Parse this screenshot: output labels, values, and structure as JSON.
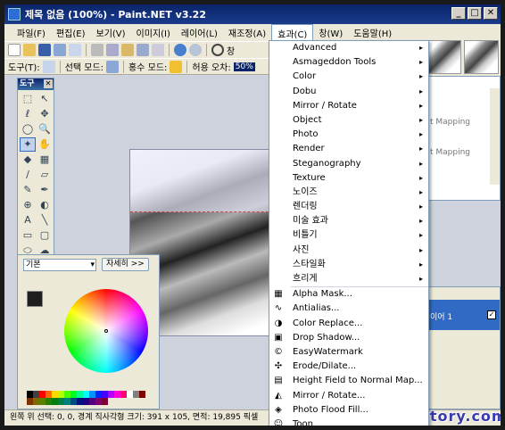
{
  "window": {
    "title": "제목 없음 (100%) - Paint.NET v3.22",
    "buttons": {
      "minimize": "_",
      "maximize": "□",
      "close": "✕"
    }
  },
  "menubar": {
    "items": [
      "파일(F)",
      "편집(E)",
      "보기(V)",
      "이미지(I)",
      "레이어(L)",
      "재조정(A)",
      "효과(C)",
      "창(W)",
      "도움말(H)"
    ],
    "active_index": 6
  },
  "toolbar1": {
    "zoom_label": "창"
  },
  "toolbar2": {
    "tool_label": "도구(T):",
    "selection_mode_label": "선택 모드:",
    "flood_mode_label": "홍수 모드:",
    "tolerance_label": "허용 오차:",
    "tolerance_value": "50%"
  },
  "tools_panel": {
    "title": "도구",
    "close": "✕",
    "icons": [
      "rect-select-icon",
      "move-selection-icon",
      "lasso-icon",
      "move-icon",
      "ellipse-select-icon",
      "zoom-icon",
      "magic-wand-icon",
      "pan-icon",
      "paint-bucket-icon",
      "gradient-icon",
      "paintbrush-icon",
      "eraser-icon",
      "pencil-icon",
      "color-picker-icon",
      "clone-stamp-icon",
      "recolor-icon",
      "text-icon",
      "line-icon",
      "rectangle-icon",
      "rounded-rect-icon",
      "ellipse-icon",
      "freeform-icon"
    ],
    "glyphs": [
      "⬚",
      "↖",
      "ℓ",
      "✥",
      "◯",
      "🔍",
      "✦",
      "✋",
      "◆",
      "▦",
      "∕",
      "▱",
      "✎",
      "✒",
      "⊕",
      "◐",
      "A",
      "╲",
      "▭",
      "▢",
      "⬭",
      "☁"
    ],
    "selected_index": 6
  },
  "colors_panel": {
    "palette_mode": "기본",
    "more_button": "자세히 >>",
    "primary_color": "#1e1e1e",
    "secondary_color": "#ffffff",
    "palette": [
      "#000000",
      "#404040",
      "#ff0000",
      "#ff6a00",
      "#ffd800",
      "#b6ff00",
      "#4cff00",
      "#00ff21",
      "#00ff90",
      "#00ffff",
      "#0094ff",
      "#0026ff",
      "#4800ff",
      "#b200ff",
      "#ff00dc",
      "#ff006e",
      "#ffffff",
      "#808080",
      "#7f0000",
      "#7f3300",
      "#7f6a00",
      "#5b7f00",
      "#267f00",
      "#007f0e",
      "#007f46",
      "#007f7f",
      "#004a7f",
      "#00137f",
      "#21007f",
      "#57007f",
      "#7f006e",
      "#7f0037"
    ]
  },
  "history_panel": {
    "items": [
      "t Mapping",
      "t Mapping"
    ]
  },
  "layers_panel": {
    "layer_name": "이어 1",
    "visible_check": "✓"
  },
  "effects_menu": {
    "submenus": [
      "Advanced",
      "Asmageddon Tools",
      "Color",
      "Dobu",
      "Mirror / Rotate",
      "Object",
      "Photo",
      "Render",
      "Steganography",
      "Texture",
      "노이즈",
      "렌더링",
      "미술 효과",
      "비틀기",
      "사진",
      "스타일화",
      "흐리게"
    ],
    "arrow": "▸",
    "items": [
      "Alpha Mask...",
      "Antialias...",
      "Color Replace...",
      "Drop Shadow...",
      "EasyWatermark",
      "Erode/Dilate...",
      "Height Field to Normal Map...",
      "Mirror / Rotate...",
      "Photo Flood Fill...",
      "Toon"
    ],
    "item_icons": [
      "alpha-mask-icon",
      "antialias-icon",
      "color-replace-icon",
      "drop-shadow-icon",
      "watermark-icon",
      "erode-dilate-icon",
      "height-field-icon",
      "mirror-rotate-icon",
      "photo-flood-icon",
      "toon-icon"
    ],
    "item_glyphs": [
      "▦",
      "∿",
      "◑",
      "▣",
      "©",
      "✣",
      "▤",
      "◭",
      "◈",
      "☺"
    ]
  },
  "statusbar": {
    "text": "왼쪽 위 선택: 0, 0, 경계 직사각형 크기: 391 x 105, 면적: 19,895 픽셀"
  },
  "watermark": "muzbox.tistory.com"
}
